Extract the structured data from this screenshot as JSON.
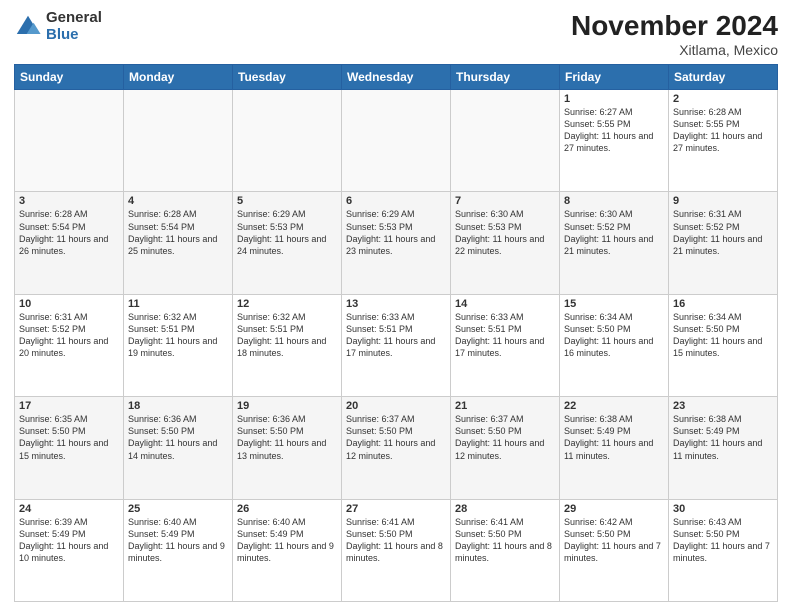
{
  "header": {
    "logo_general": "General",
    "logo_blue": "Blue",
    "month_title": "November 2024",
    "location": "Xitlama, Mexico"
  },
  "weekdays": [
    "Sunday",
    "Monday",
    "Tuesday",
    "Wednesday",
    "Thursday",
    "Friday",
    "Saturday"
  ],
  "weeks": [
    [
      {
        "day": "",
        "info": ""
      },
      {
        "day": "",
        "info": ""
      },
      {
        "day": "",
        "info": ""
      },
      {
        "day": "",
        "info": ""
      },
      {
        "day": "",
        "info": ""
      },
      {
        "day": "1",
        "info": "Sunrise: 6:27 AM\nSunset: 5:55 PM\nDaylight: 11 hours and 27 minutes."
      },
      {
        "day": "2",
        "info": "Sunrise: 6:28 AM\nSunset: 5:55 PM\nDaylight: 11 hours and 27 minutes."
      }
    ],
    [
      {
        "day": "3",
        "info": "Sunrise: 6:28 AM\nSunset: 5:54 PM\nDaylight: 11 hours and 26 minutes."
      },
      {
        "day": "4",
        "info": "Sunrise: 6:28 AM\nSunset: 5:54 PM\nDaylight: 11 hours and 25 minutes."
      },
      {
        "day": "5",
        "info": "Sunrise: 6:29 AM\nSunset: 5:53 PM\nDaylight: 11 hours and 24 minutes."
      },
      {
        "day": "6",
        "info": "Sunrise: 6:29 AM\nSunset: 5:53 PM\nDaylight: 11 hours and 23 minutes."
      },
      {
        "day": "7",
        "info": "Sunrise: 6:30 AM\nSunset: 5:53 PM\nDaylight: 11 hours and 22 minutes."
      },
      {
        "day": "8",
        "info": "Sunrise: 6:30 AM\nSunset: 5:52 PM\nDaylight: 11 hours and 21 minutes."
      },
      {
        "day": "9",
        "info": "Sunrise: 6:31 AM\nSunset: 5:52 PM\nDaylight: 11 hours and 21 minutes."
      }
    ],
    [
      {
        "day": "10",
        "info": "Sunrise: 6:31 AM\nSunset: 5:52 PM\nDaylight: 11 hours and 20 minutes."
      },
      {
        "day": "11",
        "info": "Sunrise: 6:32 AM\nSunset: 5:51 PM\nDaylight: 11 hours and 19 minutes."
      },
      {
        "day": "12",
        "info": "Sunrise: 6:32 AM\nSunset: 5:51 PM\nDaylight: 11 hours and 18 minutes."
      },
      {
        "day": "13",
        "info": "Sunrise: 6:33 AM\nSunset: 5:51 PM\nDaylight: 11 hours and 17 minutes."
      },
      {
        "day": "14",
        "info": "Sunrise: 6:33 AM\nSunset: 5:51 PM\nDaylight: 11 hours and 17 minutes."
      },
      {
        "day": "15",
        "info": "Sunrise: 6:34 AM\nSunset: 5:50 PM\nDaylight: 11 hours and 16 minutes."
      },
      {
        "day": "16",
        "info": "Sunrise: 6:34 AM\nSunset: 5:50 PM\nDaylight: 11 hours and 15 minutes."
      }
    ],
    [
      {
        "day": "17",
        "info": "Sunrise: 6:35 AM\nSunset: 5:50 PM\nDaylight: 11 hours and 15 minutes."
      },
      {
        "day": "18",
        "info": "Sunrise: 6:36 AM\nSunset: 5:50 PM\nDaylight: 11 hours and 14 minutes."
      },
      {
        "day": "19",
        "info": "Sunrise: 6:36 AM\nSunset: 5:50 PM\nDaylight: 11 hours and 13 minutes."
      },
      {
        "day": "20",
        "info": "Sunrise: 6:37 AM\nSunset: 5:50 PM\nDaylight: 11 hours and 12 minutes."
      },
      {
        "day": "21",
        "info": "Sunrise: 6:37 AM\nSunset: 5:50 PM\nDaylight: 11 hours and 12 minutes."
      },
      {
        "day": "22",
        "info": "Sunrise: 6:38 AM\nSunset: 5:49 PM\nDaylight: 11 hours and 11 minutes."
      },
      {
        "day": "23",
        "info": "Sunrise: 6:38 AM\nSunset: 5:49 PM\nDaylight: 11 hours and 11 minutes."
      }
    ],
    [
      {
        "day": "24",
        "info": "Sunrise: 6:39 AM\nSunset: 5:49 PM\nDaylight: 11 hours and 10 minutes."
      },
      {
        "day": "25",
        "info": "Sunrise: 6:40 AM\nSunset: 5:49 PM\nDaylight: 11 hours and 9 minutes."
      },
      {
        "day": "26",
        "info": "Sunrise: 6:40 AM\nSunset: 5:49 PM\nDaylight: 11 hours and 9 minutes."
      },
      {
        "day": "27",
        "info": "Sunrise: 6:41 AM\nSunset: 5:50 PM\nDaylight: 11 hours and 8 minutes."
      },
      {
        "day": "28",
        "info": "Sunrise: 6:41 AM\nSunset: 5:50 PM\nDaylight: 11 hours and 8 minutes."
      },
      {
        "day": "29",
        "info": "Sunrise: 6:42 AM\nSunset: 5:50 PM\nDaylight: 11 hours and 7 minutes."
      },
      {
        "day": "30",
        "info": "Sunrise: 6:43 AM\nSunset: 5:50 PM\nDaylight: 11 hours and 7 minutes."
      }
    ]
  ]
}
